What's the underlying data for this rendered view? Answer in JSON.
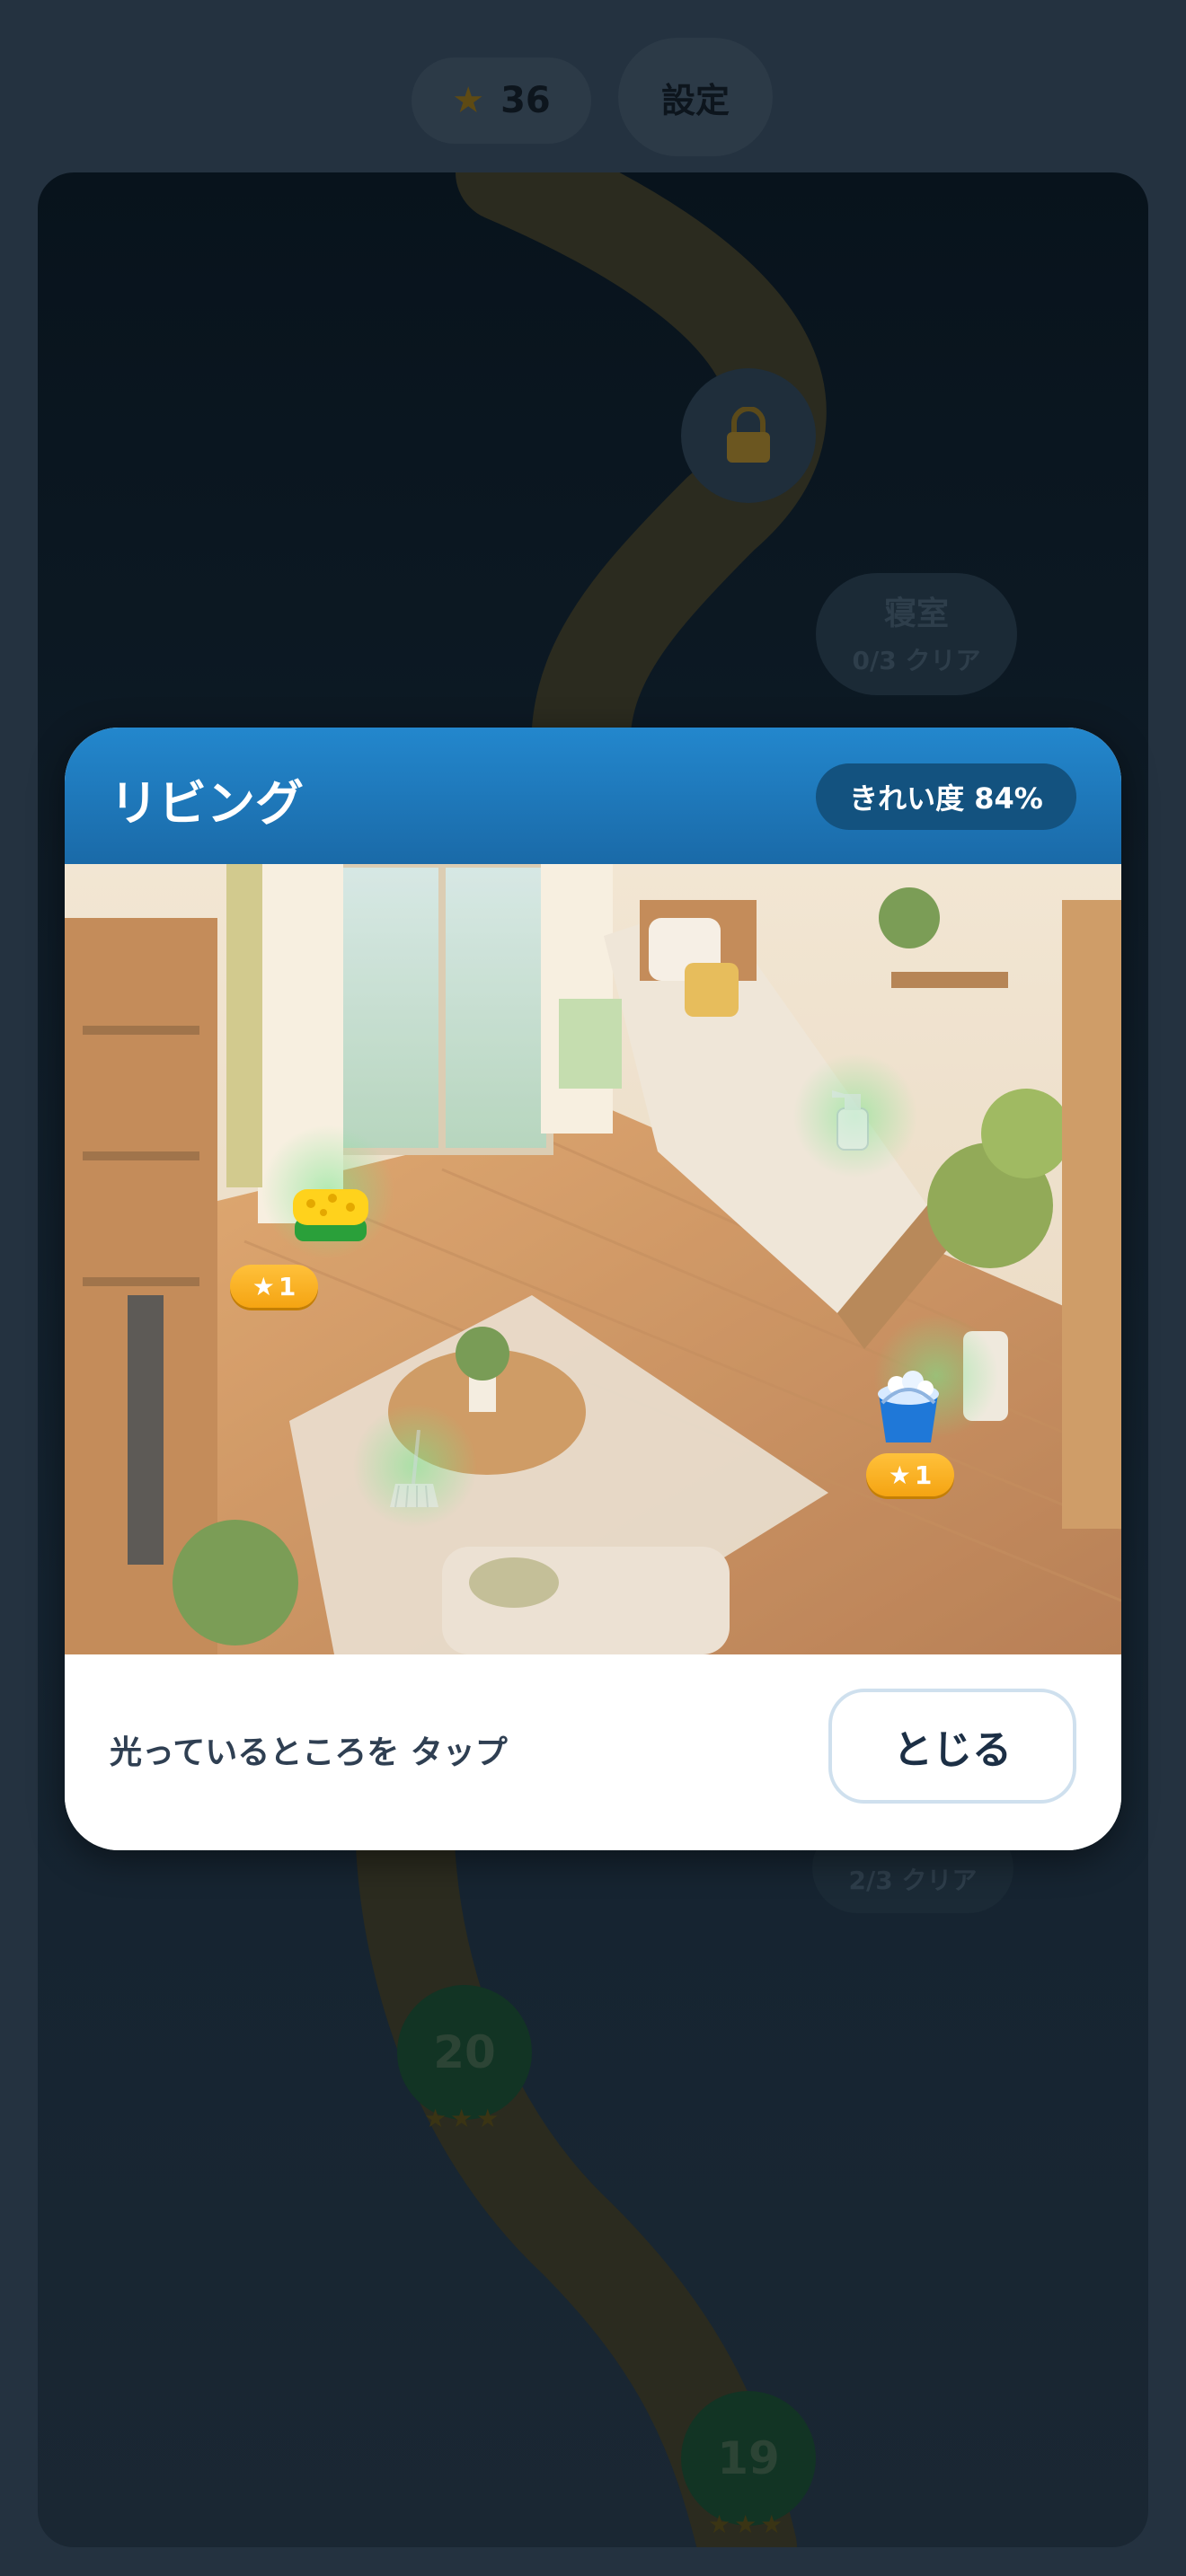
{
  "topbar": {
    "star_icon": "star-icon",
    "star_count": "36",
    "settings_label": "設定"
  },
  "map": {
    "locked_icon": "lock-icon",
    "bedroom_badge": {
      "name": "寝室",
      "progress": "0/3 クリア"
    },
    "other_badge": {
      "progress": "2/3 クリア"
    },
    "level_20": {
      "number": "20",
      "stars": "★★★"
    },
    "level_19": {
      "number": "19",
      "stars": "★★★"
    }
  },
  "modal": {
    "title": "リビング",
    "cleanliness": "きれい度 84%",
    "items": [
      {
        "icon": "sponge-icon",
        "reward": "1"
      },
      {
        "icon": "water-bucket-icon",
        "reward": "1"
      },
      {
        "icon": "spray-bottle-icon"
      },
      {
        "icon": "mop-icon"
      }
    ],
    "hint": "光っているところを タップ",
    "close_label": "とじる"
  },
  "colors": {
    "header": "#1f79bd",
    "badge": "#13527f",
    "reward": "#f9b020",
    "glow": "#78e68c"
  }
}
